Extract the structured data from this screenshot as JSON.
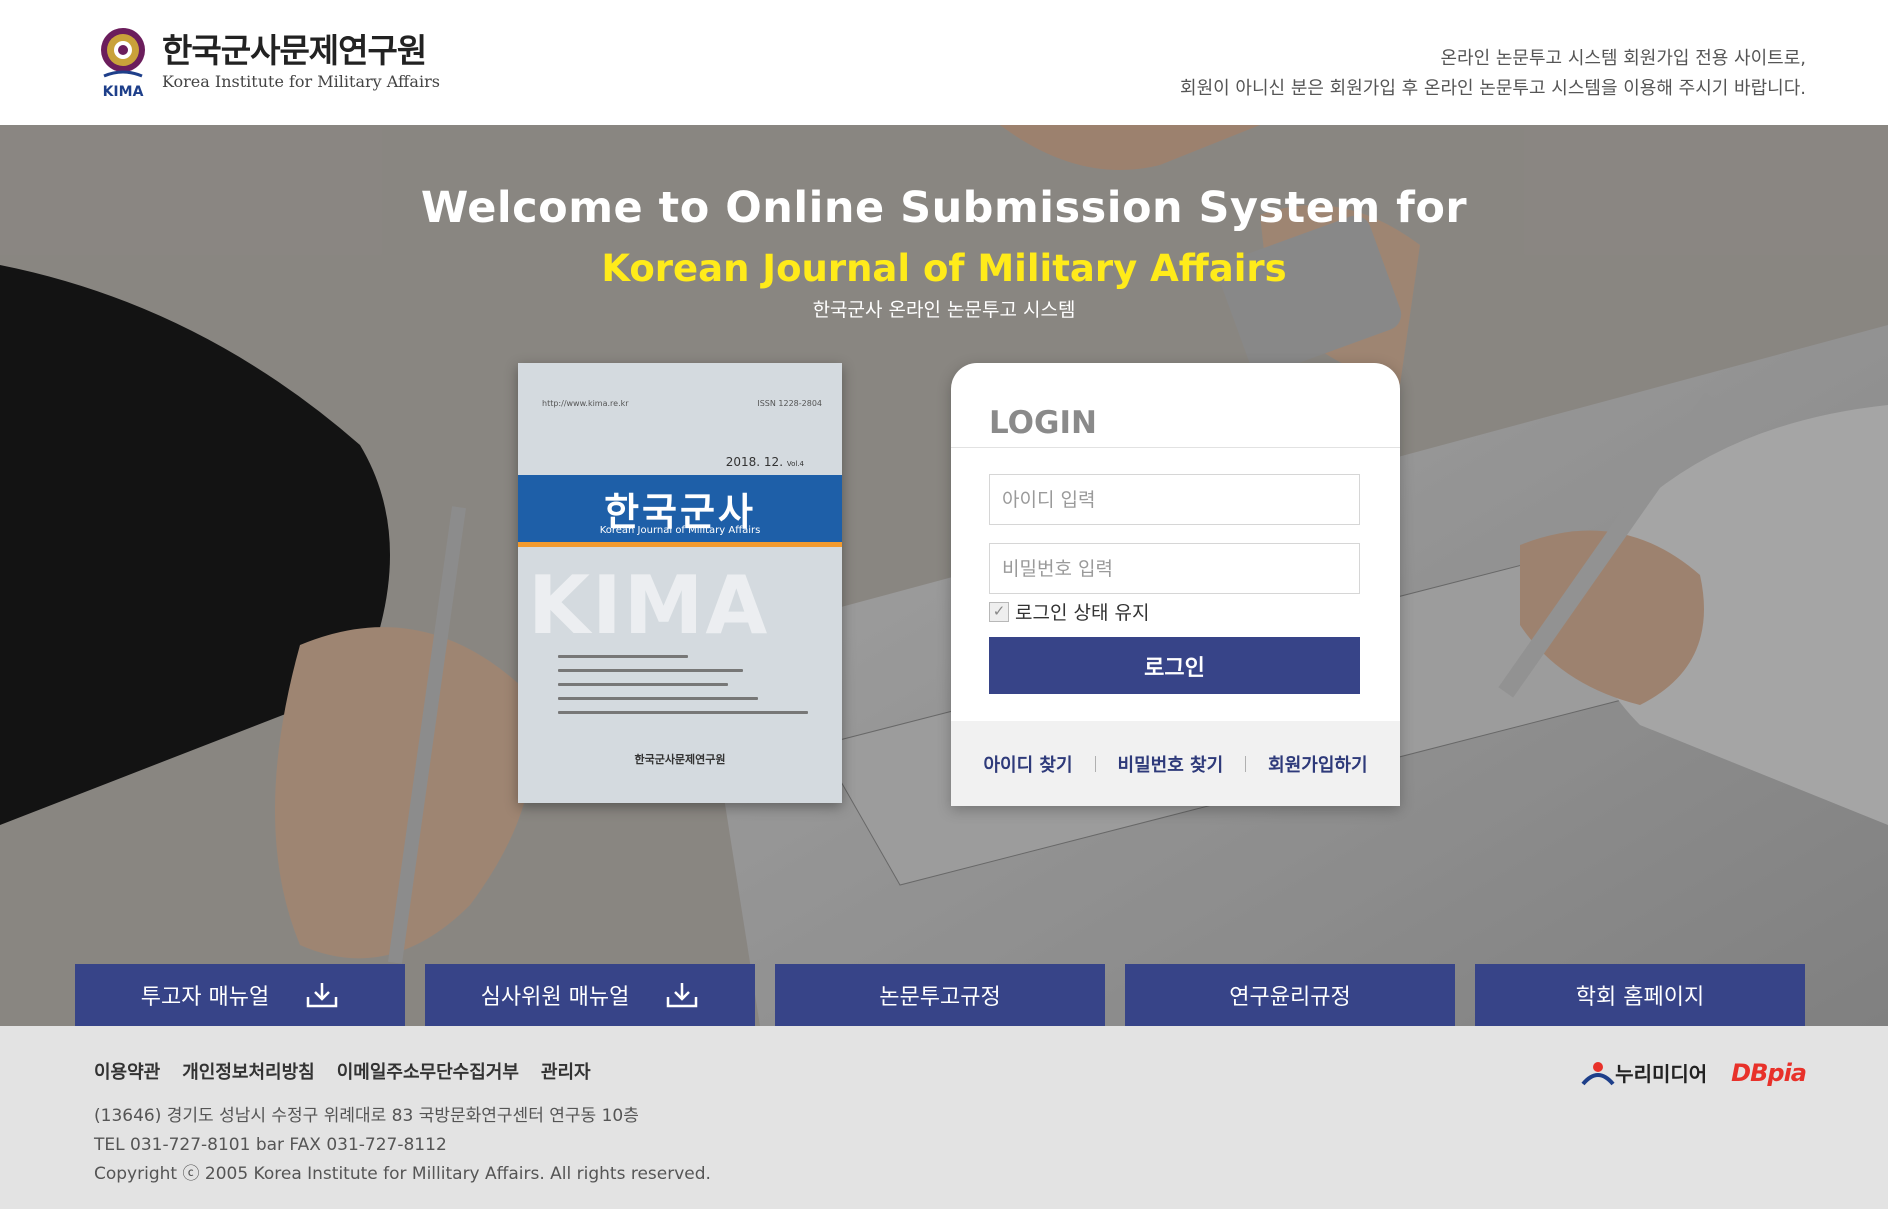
{
  "header": {
    "logo_ko": "한국군사문제연구원",
    "logo_en": "Korea Institute for Military Affairs",
    "logo_badge": "KIMA",
    "notice_line1": "온라인 논문투고 시스템 회원가입 전용 사이트로,",
    "notice_line2": "회원이 아니신 분은 회원가입 후 온라인 논문투고 시스템을 이용해 주시기 바랍니다."
  },
  "hero": {
    "welcome_line1": "Welcome to Online Submission System for",
    "welcome_line2": "Korean Journal of Military Affairs",
    "welcome_line3": "한국군사 온라인 논문투고 시스템"
  },
  "cover": {
    "url": "http://www.kima.re.kr",
    "issn": "ISSN 1228-2804",
    "date": "2018. 12.",
    "vol": "Vol.4",
    "title": "한국군사",
    "subtitle": "Korean Journal of Military Affairs",
    "watermark": "KIMA",
    "publisher": "한국군사문제연구원"
  },
  "login": {
    "title": "LOGIN",
    "id_placeholder": "아이디 입력",
    "pw_placeholder": "비밀번호 입력",
    "remember_label": "로그인 상태 유지",
    "button_label": "로그인",
    "links": [
      "아이디 찾기",
      "비밀번호 찾기",
      "회원가입하기"
    ]
  },
  "menu": {
    "items": [
      "투고자 매뉴얼",
      "심사위원 매뉴얼",
      "논문투고규정",
      "연구윤리규정",
      "학회 홈페이지"
    ]
  },
  "footer": {
    "links": [
      "이용약관",
      "개인정보처리방침",
      "이메일주소무단수집거부",
      "관리자"
    ],
    "address": "(13646) 경기도 성남시 수정구 위례대로 83 국방문화연구센터 연구동 10층",
    "tel": "TEL 031-727-8101 bar FAX 031-727-8112",
    "copyright": "Copyright ⓒ 2005 Korea Institute for Millitary Affairs. All rights reserved.",
    "partner1": "누리미디어",
    "partner2": "DBpia"
  },
  "colors": {
    "primary_navy": "#374488",
    "accent_yellow": "#ffeb1a",
    "cover_blue": "#1e5fa8",
    "dbpia_red": "#e8312a"
  }
}
